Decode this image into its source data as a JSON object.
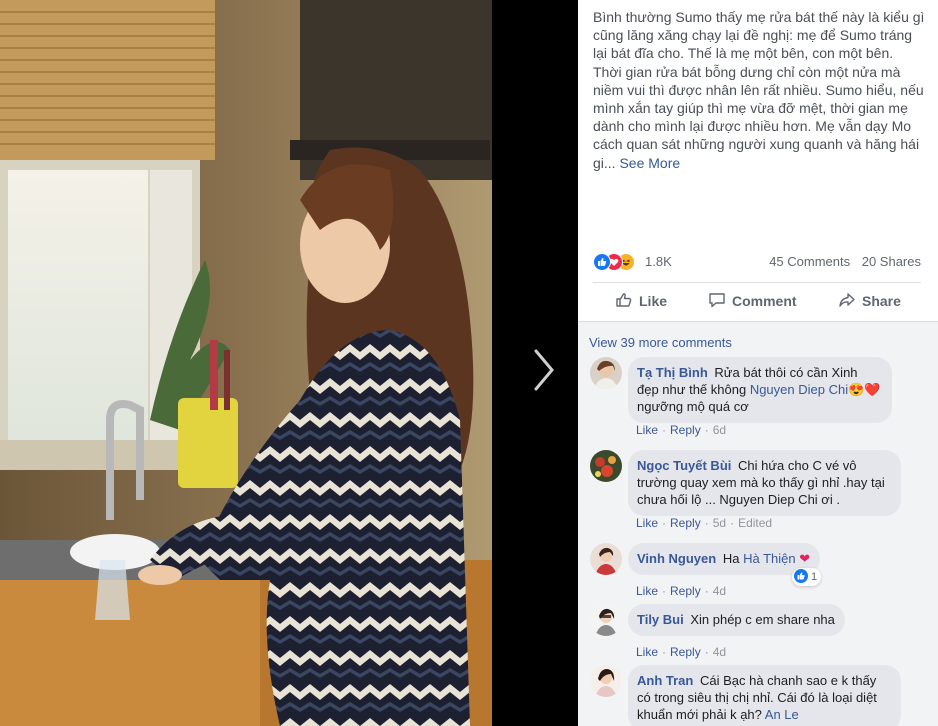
{
  "post": {
    "caption": "Bình thường Sumo thấy mẹ rửa bát thế này là kiểu gì cũng lăng xăng chạy lại đề nghị: mẹ để Sumo tráng lại bát đĩa cho. Thế là mẹ một bên, con một bên. Thời gian rửa bát bỗng dưng chỉ còn một nửa mà niềm vui thì được nhân lên rất nhiều. Sumo hiểu, nếu mình xắn tay giúp thì mẹ vừa đỡ mệt, thời gian mẹ dành cho mình lại được nhiều hơn. Mẹ vẫn dạy Mo cách quan sát những người xung quanh và hăng hái gi...",
    "see_more": "See More"
  },
  "stats": {
    "reactions": "1.8K",
    "comments": "45 Comments",
    "shares": "20 Shares",
    "reaction_icons": [
      "like-icon",
      "love-icon",
      "haha-icon"
    ]
  },
  "actions": {
    "like": "Like",
    "comment": "Comment",
    "share": "Share"
  },
  "comments_header": {
    "view_more": "View 39 more comments"
  },
  "comments": [
    {
      "author": "Tạ Thị Bình",
      "text_1": "Rửa bát thôi có cần Xinh đẹp như thế không",
      "mention": "Nguyen Diep Chi",
      "emoji": "😍❤️",
      "text_2": "ngưỡng mộ quá cơ",
      "like": "Like",
      "reply": "Reply",
      "time": "6d"
    },
    {
      "author": "Ngọc Tuyết Bùi",
      "text_1": "Chi hứa cho C vé vô trường quay xem mà ko thấy gì nhỉ .hay tại chưa hối lộ ... Nguyen Diep Chi ơi .",
      "like": "Like",
      "reply": "Reply",
      "time": "5d",
      "edited": "Edited"
    },
    {
      "author": "Vinh Nguyen",
      "text_1": "Ha",
      "mention": "Hà Thiện",
      "emoji": "❤",
      "reaction_count": "1",
      "like": "Like",
      "reply": "Reply",
      "time": "4d"
    },
    {
      "author": "Tily Bui",
      "text_1": "Xin phép c em share nha",
      "like": "Like",
      "reply": "Reply",
      "time": "4d"
    },
    {
      "author": "Anh Tran",
      "text_1": "Cái Bạc hà chanh sao e k thấy có trong siêu thị chị nhỉ. Cái đó là loại diệt khuẩn mới phải k ạh?",
      "mention": "An Le"
    }
  ],
  "colors": {
    "link": "#385898",
    "bubble": "#e4e6eb",
    "panel_bg": "#f2f3f5",
    "like_blue": "#1877f2",
    "love_red": "#f0284a",
    "haha_yellow": "#f7b125"
  }
}
